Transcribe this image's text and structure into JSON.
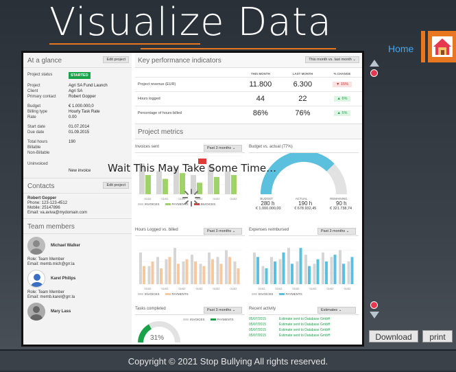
{
  "page": {
    "title": "Visualize Data",
    "home": "Home",
    "footer": "Copyright © 2021 Stop Bullying All rights reserved."
  },
  "buttons": {
    "download": "Download",
    "print": "print"
  },
  "overlay": "Wait This May Take Some Time…",
  "glance": {
    "title": "At a glance",
    "edit": "Edit project",
    "status_label": "Project status",
    "status_value": "STARTED",
    "rows": [
      {
        "k": "Project",
        "v": "Agri SA Fund Launch"
      },
      {
        "k": "Client",
        "v": "Agri SA"
      },
      {
        "k": "Primary contact",
        "v": "Robert Gopper"
      }
    ],
    "rows2": [
      {
        "k": "Budget",
        "v": "€ 1.000.000,0"
      },
      {
        "k": "Billing type",
        "v": "Hourly Task Rate"
      },
      {
        "k": "Rate",
        "v": "0.00"
      }
    ],
    "rows3": [
      {
        "k": "Start date",
        "v": "01.07.2014"
      },
      {
        "k": "Due date",
        "v": "01.09.2015"
      }
    ],
    "rows4": [
      {
        "k": "Total hours",
        "v": "190"
      },
      {
        "k": "Billable",
        "v": ""
      },
      {
        "k": "Non-Billable",
        "v": ""
      }
    ],
    "uninvoiced": "Uninvoiced",
    "new_invoice": "New invoice"
  },
  "contacts": {
    "title": "Contacts",
    "edit": "Edit project",
    "name": "Robert Gopper",
    "phone": "Phone: 123-123-4512",
    "mobile": "Mobile: 25147896",
    "email": "Email: va.aviva@mydomain.com"
  },
  "team": {
    "title": "Team members",
    "members": [
      {
        "name": "Michael Walker",
        "role": "Role: Team Member",
        "email": "Email: memb.mich@grr.la"
      },
      {
        "name": "Karel Philips",
        "role": "Role: Team Member",
        "email": "Email: memb.karel@grr.la"
      },
      {
        "name": "Mary Lass",
        "role": "",
        "email": ""
      }
    ]
  },
  "kpi": {
    "title": "Key performance indicators",
    "period": "This month vs. last month",
    "cols": [
      "THIS MONTH",
      "LAST MONTH",
      "% CHANGE"
    ],
    "rows": [
      {
        "label": "Project revenue (EUR)",
        "this": "11.800",
        "last": "6.300",
        "change": "15%",
        "dir": "down",
        "arrow": "▼"
      },
      {
        "label": "Hours logged",
        "this": "44",
        "last": "22",
        "change": "6%",
        "dir": "up",
        "arrow": "▲"
      },
      {
        "label": "Percentage of hours billed",
        "this": "86%",
        "last": "76%",
        "change": "5%",
        "dir": "up",
        "arrow": "▲"
      }
    ]
  },
  "metrics": {
    "title": "Project metrics",
    "invoices": {
      "title": "Invoices sent",
      "period": "Past 3 months",
      "legend": [
        "INVOICES",
        "PAYMENTS",
        "INVOICES"
      ]
    },
    "budget": {
      "title": "Budget vs. actual (77%)",
      "cols": [
        "BUDGET",
        "ACTUAL",
        "REMAINING"
      ],
      "hours": [
        "280 h",
        "190 h",
        "90 h"
      ],
      "money": [
        "€ 1.000.000,00",
        "€ 678.932,45",
        "€ 321.738,74"
      ]
    },
    "hours": {
      "title": "Hours Logged vs. billed",
      "period": "Past 3 months",
      "legend": [
        "INVOICES",
        "PAYMENTS"
      ]
    },
    "expenses": {
      "title": "Expenses reimbursed",
      "period": "Past 3 months",
      "legend": [
        "INVOICES",
        "PAYMENTS"
      ]
    },
    "tasks": {
      "title": "Tasks completed",
      "period": "Past 3 months",
      "legend": [
        "INVOICES",
        "PAYMENTS"
      ],
      "percent": "31%"
    },
    "activity": {
      "title": "Recent activity",
      "filter": "Estimates",
      "items": [
        {
          "date": "05/07/2015",
          "text": "Estimate sent to Database GmbH"
        },
        {
          "date": "05/07/2015",
          "text": "Estimate sent to Database GmbH"
        },
        {
          "date": "05/07/2015",
          "text": "Estimate sent to Database GmbH"
        },
        {
          "date": "05/07/2015",
          "text": "Estimate sent to Database GmbH"
        }
      ]
    },
    "xticks": [
      "01/02",
      "01/02",
      "01/02",
      "01/02",
      "01/02",
      "01/02"
    ]
  },
  "colors": {
    "accent": "#e87722",
    "home_blue": "#3fa9f5",
    "green": "#1aa24a",
    "orange_bar": "#f5c9a0",
    "teal_bar": "#5bc0de",
    "gray_bar": "#d6d6d6"
  },
  "chart_data": [
    {
      "type": "bar",
      "series": [
        {
          "name": "INVOICES",
          "values": [
            0.8,
            0.6,
            0.7,
            0.5,
            0.75,
            0.6
          ]
        },
        {
          "name": "PAYMENTS",
          "values": [
            0.5,
            0.4,
            0.55,
            0.3,
            0.45,
            0.5
          ]
        }
      ]
    },
    {
      "type": "bar",
      "series": [
        {
          "name": "INVOICES",
          "values": [
            0.7,
            0.4,
            0.6,
            0.55,
            0.8,
            0.5,
            0.65,
            0.45,
            0.7,
            0.6,
            0.75,
            0.5
          ]
        },
        {
          "name": "PAYMENTS",
          "values": [
            0.4,
            0.5,
            0.35,
            0.6,
            0.45,
            0.55,
            0.5,
            0.4,
            0.55,
            0.45,
            0.6,
            0.35
          ]
        }
      ]
    },
    {
      "type": "bar",
      "series": [
        {
          "name": "INVOICES",
          "values": [
            0.7,
            0.4,
            0.6,
            0.55,
            0.8,
            0.5,
            0.65,
            0.45,
            0.7,
            0.6,
            0.75,
            0.5
          ]
        },
        {
          "name": "PAYMENTS",
          "values": [
            0.6,
            0.35,
            0.5,
            0.7,
            0.45,
            0.8,
            0.4,
            0.55,
            0.5,
            0.65,
            0.45,
            0.6
          ]
        }
      ]
    }
  ]
}
